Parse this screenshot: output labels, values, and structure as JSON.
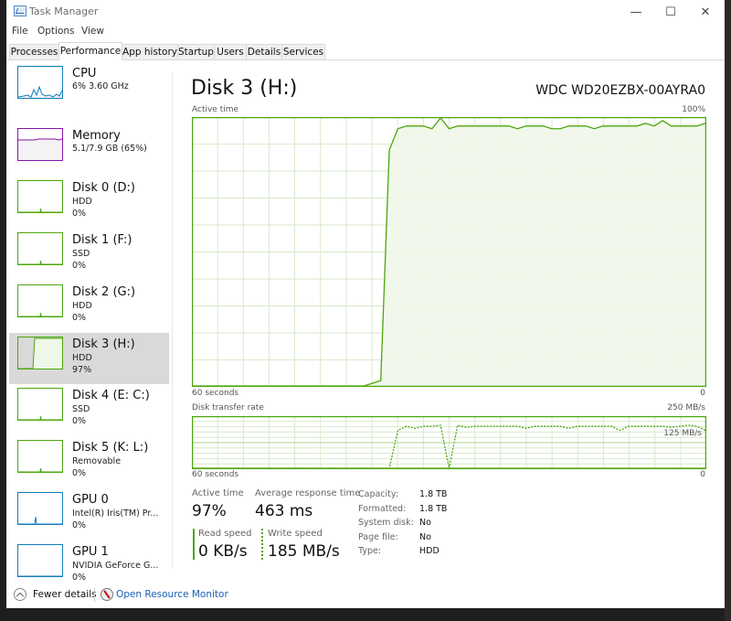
{
  "window": {
    "title": "Task Manager",
    "controls": {
      "minimize": "—",
      "maximize": "☐",
      "close": "✕"
    }
  },
  "menu": [
    "File",
    "Options",
    "View"
  ],
  "tabs": [
    {
      "label": "Processes",
      "active": false
    },
    {
      "label": "Performance",
      "active": true
    },
    {
      "label": "App history",
      "active": false
    },
    {
      "label": "Startup",
      "active": false
    },
    {
      "label": "Users",
      "active": false
    },
    {
      "label": "Details",
      "active": false
    },
    {
      "label": "Services",
      "active": false
    }
  ],
  "sidebar": {
    "items": [
      {
        "name": "CPU",
        "sub": "6% 3.60 GHz",
        "val": "",
        "color": "#117dbb",
        "fill": "#f1f6fa",
        "kind": "cpu"
      },
      {
        "name": "Memory",
        "sub": "5.1/7.9 GB (65%)",
        "val": "",
        "color": "#8b12ae",
        "fill": "#f4f2f4",
        "kind": "mem"
      },
      {
        "name": "Disk 0 (D:)",
        "sub": "HDD",
        "val": "0%",
        "color": "#4da60c",
        "fill": "#eff7e8",
        "kind": "idle"
      },
      {
        "name": "Disk 1 (F:)",
        "sub": "SSD",
        "val": "0%",
        "color": "#4da60c",
        "fill": "#eff7e8",
        "kind": "idle"
      },
      {
        "name": "Disk 2 (G:)",
        "sub": "HDD",
        "val": "0%",
        "color": "#4da60c",
        "fill": "#eff7e8",
        "kind": "idle"
      },
      {
        "name": "Disk 3 (H:)",
        "sub": "HDD",
        "val": "97%",
        "color": "#4da60c",
        "fill": "#eff7e8",
        "kind": "busy",
        "selected": true
      },
      {
        "name": "Disk 4 (E: C:)",
        "sub": "SSD",
        "val": "0%",
        "color": "#4da60c",
        "fill": "#eff7e8",
        "kind": "idle"
      },
      {
        "name": "Disk 5 (K: L:)",
        "sub": "Removable",
        "val": "0%",
        "color": "#4da60c",
        "fill": "#eff7e8",
        "kind": "idle"
      },
      {
        "name": "GPU 0",
        "sub": "Intel(R) Iris(TM) Pr...",
        "val": "0%",
        "color": "#117dbb",
        "fill": "#f1f6fa",
        "kind": "gpu"
      },
      {
        "name": "GPU 1",
        "sub": "NVIDIA GeForce G...",
        "val": "0%",
        "color": "#117dbb",
        "fill": "#f1f6fa",
        "kind": "flat"
      }
    ]
  },
  "main": {
    "title": "Disk 3 (H:)",
    "model": "WDC WD20EZBX-00AYRA0",
    "accent": "#4da60c",
    "active_chart": {
      "label": "Active time",
      "max_label": "100%",
      "x_left": "60 seconds",
      "x_right": "0"
    },
    "transfer_chart": {
      "label": "Disk transfer rate",
      "max_label": "250 MB/s",
      "mid_label": "125 MB/s",
      "x_left": "60 seconds",
      "x_right": "0"
    },
    "stats": {
      "active_time_label": "Active time",
      "active_time_value": "97%",
      "avg_response_label": "Average response time",
      "avg_response_value": "463 ms",
      "read_label": "Read speed",
      "read_value": "0 KB/s",
      "write_label": "Write speed",
      "write_value": "185 MB/s"
    },
    "properties": [
      {
        "key": "Capacity:",
        "value": "1.8 TB"
      },
      {
        "key": "Formatted:",
        "value": "1.8 TB"
      },
      {
        "key": "System disk:",
        "value": "No"
      },
      {
        "key": "Page file:",
        "value": "No"
      },
      {
        "key": "Type:",
        "value": "HDD"
      }
    ]
  },
  "footer": {
    "fewer_details": "Fewer details",
    "resource_monitor": "Open Resource Monitor"
  },
  "chart_data": [
    {
      "type": "area",
      "title": "Active time",
      "xlabel": "60 seconds → 0",
      "ylabel": "Active time (%)",
      "ylim": [
        0,
        100
      ],
      "xlim": [
        60,
        0
      ],
      "grid": true,
      "x": [
        60,
        59,
        58,
        57,
        56,
        55,
        54,
        53,
        52,
        51,
        50,
        49,
        48,
        47,
        46,
        45,
        44,
        43,
        42,
        41,
        40,
        39,
        38,
        37,
        36,
        35,
        34,
        33,
        32,
        31,
        30,
        29,
        28,
        27,
        26,
        25,
        24,
        23,
        22,
        21,
        20,
        19,
        18,
        17,
        16,
        15,
        14,
        13,
        12,
        11,
        10,
        9,
        8,
        7,
        6,
        5,
        4,
        3,
        2,
        1,
        0
      ],
      "values": [
        0,
        0,
        0,
        0,
        0,
        0,
        0,
        0,
        0,
        0,
        0,
        0,
        0,
        0,
        0,
        0,
        0,
        0,
        0,
        0,
        0,
        1,
        2,
        88,
        96,
        97,
        97,
        97,
        96,
        100,
        96,
        97,
        97,
        97,
        97,
        97,
        97,
        97,
        96,
        97,
        97,
        97,
        96,
        96,
        97,
        97,
        97,
        96,
        97,
        97,
        97,
        97,
        97,
        98,
        97,
        99,
        97,
        97,
        97,
        97,
        98
      ]
    },
    {
      "type": "line",
      "title": "Disk transfer rate",
      "ylabel": "MB/s",
      "ylim": [
        0,
        250
      ],
      "xlim": [
        60,
        0
      ],
      "grid": true,
      "series": [
        {
          "name": "Read speed",
          "style": "solid",
          "values": [
            0,
            0,
            0,
            0,
            0,
            0,
            0,
            0,
            0,
            0,
            0,
            0,
            0,
            0,
            0,
            0,
            0,
            0,
            0,
            0,
            0,
            0,
            0,
            0,
            0,
            0,
            0,
            0,
            0,
            0,
            0,
            0,
            0,
            0,
            0,
            0,
            0,
            0,
            0,
            0,
            0,
            0,
            0,
            0,
            0,
            0,
            0,
            0,
            0,
            0,
            0,
            0,
            0,
            0,
            0,
            0,
            0,
            0,
            0,
            0,
            0
          ]
        },
        {
          "name": "Write speed",
          "style": "dotted",
          "values": [
            0,
            0,
            0,
            0,
            0,
            0,
            0,
            0,
            0,
            0,
            0,
            0,
            0,
            0,
            0,
            0,
            0,
            0,
            0,
            0,
            0,
            0,
            0,
            0,
            185,
            205,
            195,
            205,
            205,
            210,
            0,
            210,
            200,
            205,
            205,
            205,
            205,
            205,
            205,
            195,
            205,
            205,
            205,
            205,
            195,
            205,
            205,
            205,
            205,
            205,
            185,
            205,
            205,
            205,
            205,
            205,
            200,
            205,
            210,
            205,
            185
          ]
        }
      ]
    }
  ]
}
